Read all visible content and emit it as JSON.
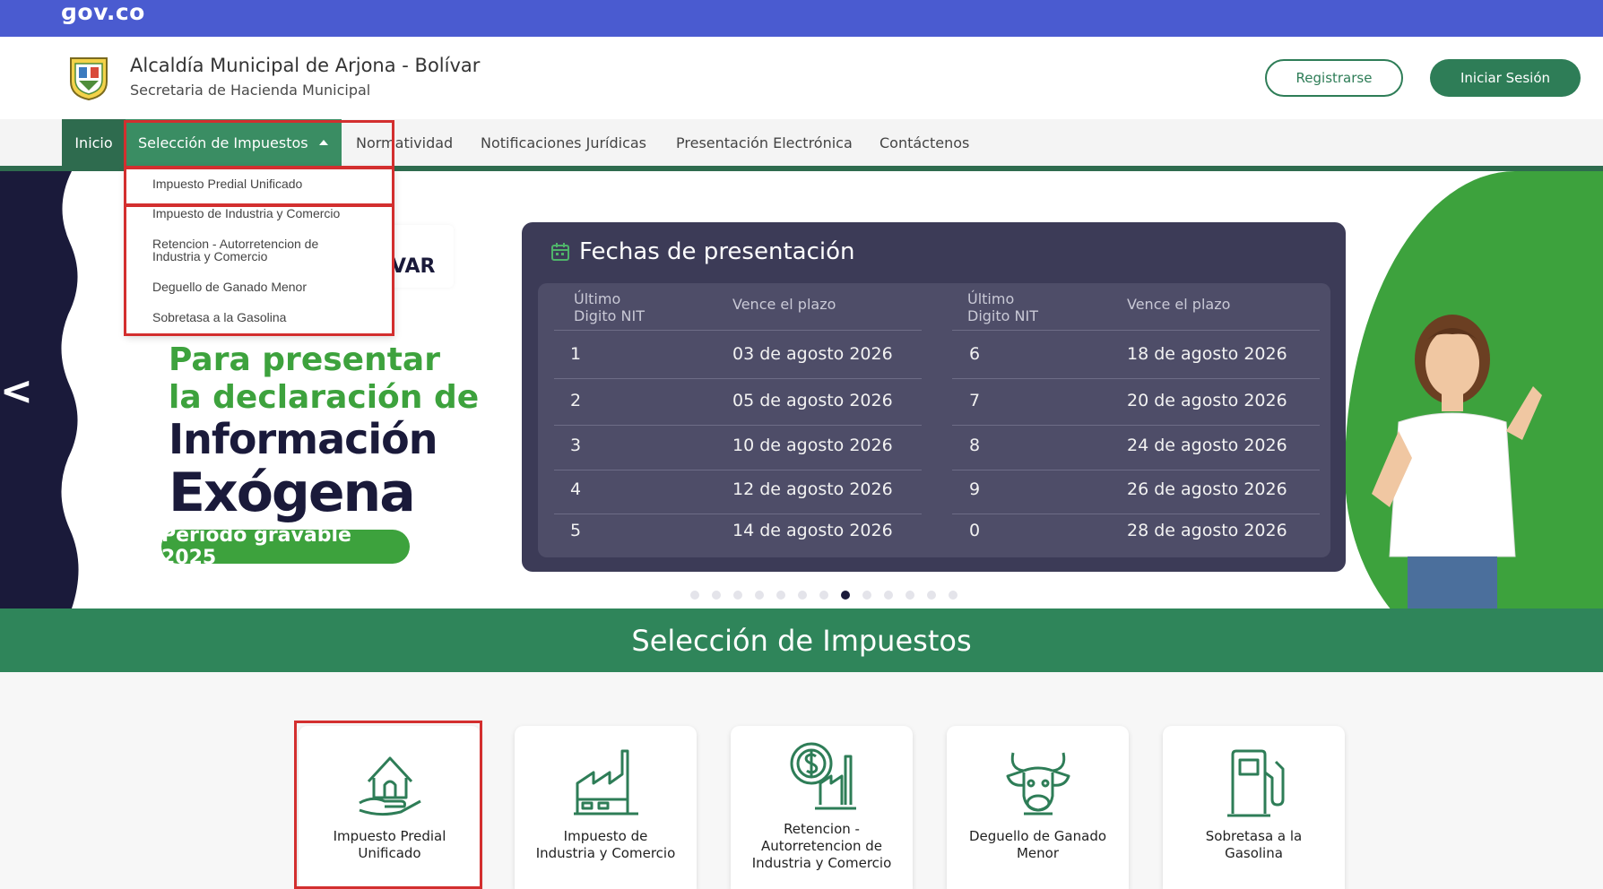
{
  "govbar": {
    "logo": "ɡov.co"
  },
  "header": {
    "title": "Alcaldía Municipal de Arjona - Bolívar",
    "subtitle": "Secretaria de Hacienda Municipal",
    "register_label": "Registrarse",
    "login_label": "Iniciar Sesión"
  },
  "nav": {
    "items": [
      {
        "label": "Inicio"
      },
      {
        "label": "Selección de Impuestos"
      },
      {
        "label": "Normatividad"
      },
      {
        "label": "Notificaciones Jurídicas"
      },
      {
        "label": "Presentación Electrónica"
      },
      {
        "label": "Contáctenos"
      }
    ],
    "dropdown": [
      "Impuesto Predial Unificado",
      "Impuesto de Industria y Comercio",
      "Retencion - Autorretencion de",
      "Industria y Comercio",
      "Deguello de Ganado Menor",
      "Sobretasa a la Gasolina"
    ]
  },
  "hero": {
    "card_fragment": "VAR",
    "line1": "Para presentar",
    "line2": "la declaración de",
    "line3": "Información",
    "line4": "Exógena",
    "pill": "Periodo gravable 2025",
    "arrow": "<",
    "panel_title": "Fechas de presentación",
    "table": {
      "col1_line1": "Último",
      "col1_line2": "Digito NIT",
      "col2": "Vence el plazo",
      "col3_line1": "Último",
      "col3_line2": "Digito NIT",
      "col4": "Vence el plazo",
      "rows": [
        [
          "1",
          "03 de agosto 2026",
          "6",
          "18 de agosto 2026"
        ],
        [
          "2",
          "05 de agosto 2026",
          "7",
          "20 de agosto 2026"
        ],
        [
          "3",
          "10 de agosto 2026",
          "8",
          "24 de agosto 2026"
        ],
        [
          "4",
          "12 de agosto 2026",
          "9",
          "26 de agosto 2026"
        ],
        [
          "5",
          "14 de agosto 2026",
          "0",
          "28 de agosto 2026"
        ]
      ]
    },
    "carousel_total": 13,
    "carousel_active": 8
  },
  "section": {
    "title": "Selección de Impuestos"
  },
  "taxes": [
    {
      "line1": "Impuesto Predial",
      "line2": "Unificado",
      "line3": ""
    },
    {
      "line1": "Impuesto de",
      "line2": "Industria y Comercio",
      "line3": ""
    },
    {
      "line1": "Retencion -",
      "line2": "Autorretencion de",
      "line3": "Industria y Comercio"
    },
    {
      "line1": "Deguello de Ganado",
      "line2": "Menor",
      "line3": ""
    },
    {
      "line1": "Sobretasa a la",
      "line2": "Gasolina",
      "line3": ""
    }
  ],
  "colors": {
    "gov_blue": "#4a5bd0",
    "brand_green": "#2e7d57",
    "accent_green": "#3da23d",
    "navy": "#1a1a3a",
    "highlight_red": "#d32f2f"
  }
}
